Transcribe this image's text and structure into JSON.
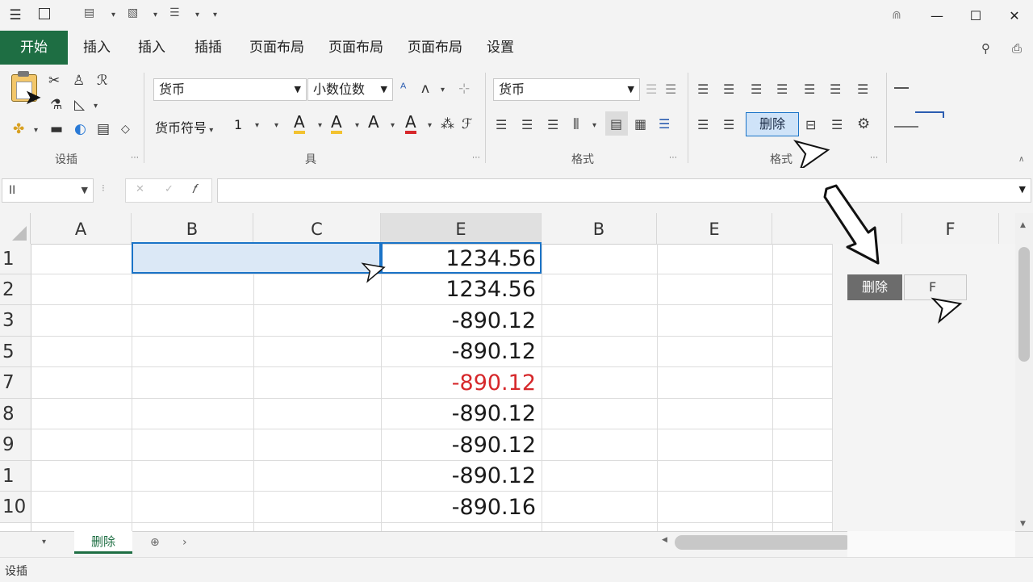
{
  "title_bar": {
    "menu_icon": "hamburger-icon",
    "quick_access": [
      "save-icon",
      "undo-icon",
      "redo-icon"
    ]
  },
  "tabs": [
    "开始",
    "插入",
    "插入",
    "插插",
    "页面布局",
    "页面布局",
    "页面布局",
    "设置"
  ],
  "ribbon": {
    "groups": [
      "设插",
      "具",
      "格式",
      "格式"
    ],
    "font_combo": "货币",
    "size_combo": "小数位数",
    "currency_label": "货币符号",
    "size_value": "1",
    "number_format_combo": "货币",
    "delete_button": "删除"
  },
  "formula_bar": {
    "name_box": "II",
    "formula": ""
  },
  "columns": [
    "A",
    "B",
    "C",
    "E",
    "B",
    "E",
    "F"
  ],
  "rows": [
    {
      "header": "1",
      "value": "1234.56",
      "negative": false
    },
    {
      "header": "2",
      "value": "1234.56",
      "negative": false
    },
    {
      "header": "3",
      "value": "-890.12",
      "negative": false
    },
    {
      "header": "5",
      "value": "-890.12",
      "negative": false
    },
    {
      "header": "7",
      "value": "-890.12",
      "negative": true
    },
    {
      "header": "8",
      "value": "-890.12",
      "negative": false
    },
    {
      "header": "9",
      "value": "-890.12",
      "negative": false
    },
    {
      "header": "1",
      "value": "-890.12",
      "negative": false
    },
    {
      "header": "10",
      "value": "-890.16",
      "negative": false
    }
  ],
  "side_panel": {
    "delete_label": "删除",
    "second_label": "F"
  },
  "sheet_tab": "删除",
  "status_text": "设插",
  "colors": {
    "accent_green": "#1e6e43",
    "selection_blue": "#1a73c7",
    "negative_red": "#d6282b"
  }
}
